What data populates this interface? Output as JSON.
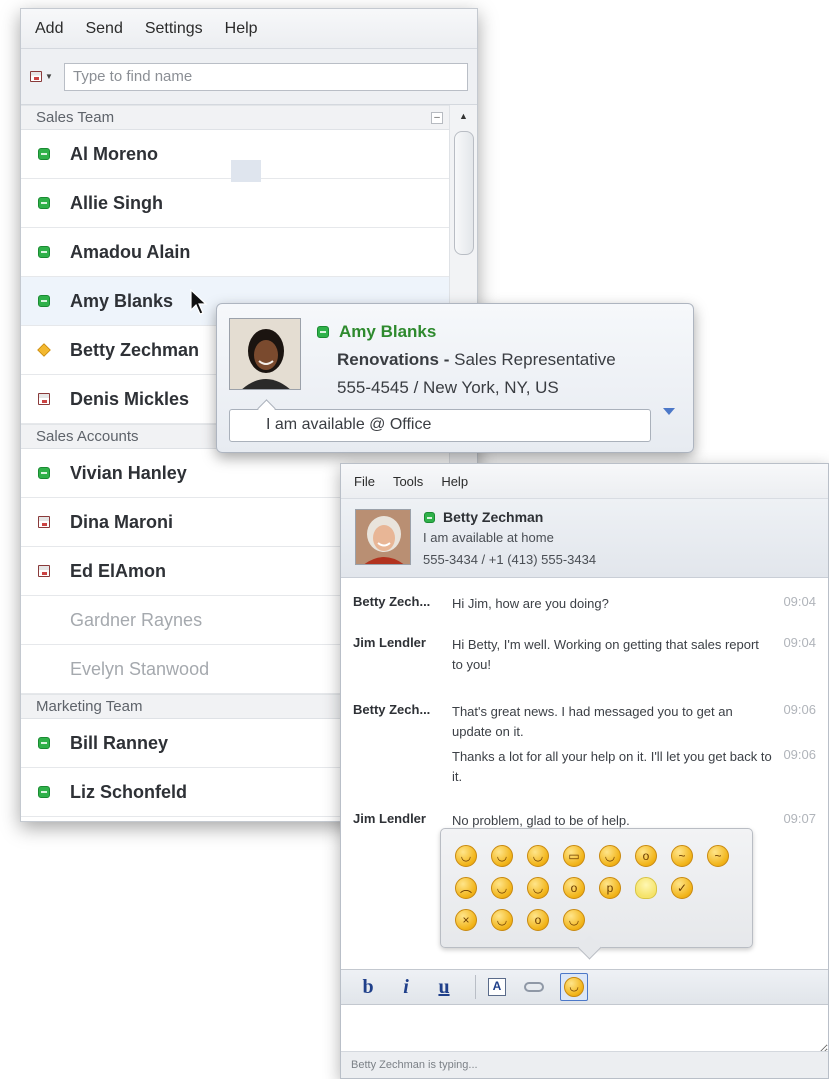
{
  "contacts_window": {
    "menu": [
      "Add",
      "Send",
      "Settings",
      "Help"
    ],
    "search": {
      "placeholder": "Type to find name",
      "value": ""
    },
    "groups": [
      {
        "name": "Sales Team",
        "contacts": [
          {
            "name": "Al Moreno",
            "status": "online"
          },
          {
            "name": "Allie Singh",
            "status": "online"
          },
          {
            "name": "Amadou Alain",
            "status": "online"
          },
          {
            "name": "Amy Blanks",
            "status": "online",
            "hovered": true
          },
          {
            "name": "Betty Zechman",
            "status": "away"
          },
          {
            "name": "Denis Mickles",
            "status": "busy"
          }
        ]
      },
      {
        "name": "Sales Accounts",
        "contacts": [
          {
            "name": "Vivian Hanley",
            "status": "online"
          },
          {
            "name": "Dina Maroni",
            "status": "busy"
          },
          {
            "name": "Ed ElAmon",
            "status": "busy"
          },
          {
            "name": "Gardner Raynes",
            "status": "offline"
          },
          {
            "name": "Evelyn Stanwood",
            "status": "offline"
          }
        ]
      },
      {
        "name": "Marketing Team",
        "contacts": [
          {
            "name": "Bill Ranney",
            "status": "online"
          },
          {
            "name": "Liz Schonfeld",
            "status": "online"
          }
        ]
      }
    ]
  },
  "contact_card": {
    "name": "Amy Blanks",
    "company": "Renovations -",
    "title": " Sales Representative",
    "phone_location": "555-4545 / New York, NY, US",
    "note": "I am available @ Office"
  },
  "chat_window": {
    "menu": [
      "File",
      "Tools",
      "Help"
    ],
    "contact": {
      "name": "Betty Zechman",
      "note": "I am available at home",
      "phone": "555-3434 / +1 (413) 555-3434"
    },
    "messages": [
      {
        "sender": "Betty Zech...",
        "text": "Hi Jim, how are you doing?",
        "time": "09:04"
      },
      {
        "sender": "Jim Lendler",
        "text": "Hi Betty, I'm well.  Working on getting that sales report to you!",
        "time": "09:04"
      },
      {
        "sender": "Betty Zech...",
        "text": "That's great news. I had messaged you to get an update on it.",
        "time": "09:06"
      },
      {
        "sender": "",
        "text": "Thanks a lot for all your help on it. I'll let you get back to it.",
        "time": "09:06"
      },
      {
        "sender": "Jim Lendler",
        "text": "No problem, glad to be of help.",
        "time": "09:07"
      }
    ],
    "toolbar": {
      "bold": "b",
      "italic": "i",
      "underline": "u",
      "font": "A"
    },
    "status_text": "Betty Zechman is typing..."
  },
  "colors": {
    "online": "#2fb14a",
    "away": "#f3b82f",
    "accent": "#4c78c8",
    "card_name": "#2e8a2e"
  }
}
